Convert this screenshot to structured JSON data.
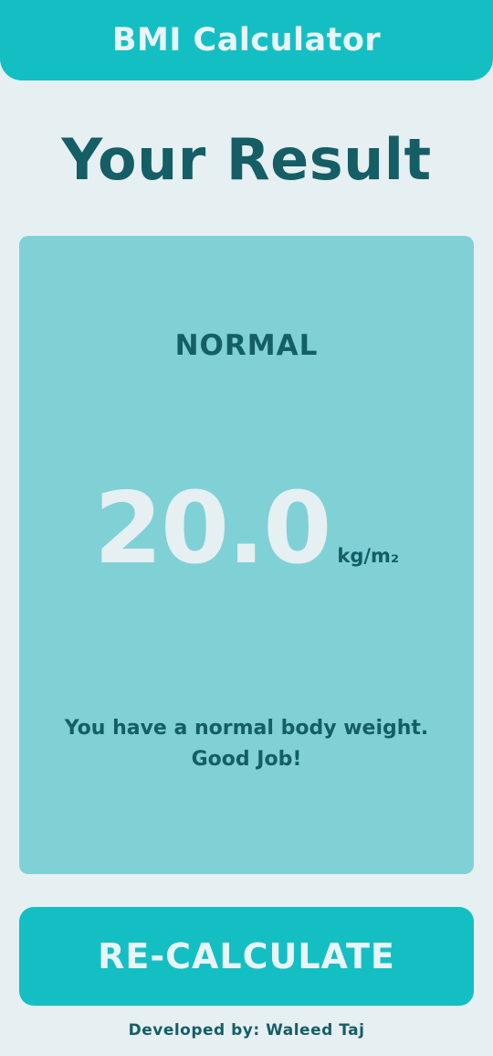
{
  "app_bar": {
    "title": "BMI Calculator"
  },
  "page": {
    "heading": "Your Result"
  },
  "result": {
    "category": "NORMAL",
    "bmi_value": "20.0",
    "unit": "kg/m₂",
    "message_line1": "You have a normal body weight.",
    "message_line2": "Good Job!"
  },
  "actions": {
    "recalculate_label": "RE-CALCULATE"
  },
  "footer": {
    "credit": "Developed by: Waleed Taj"
  },
  "colors": {
    "accent": "#14bfc4",
    "card": "#80d1d6",
    "dark_text": "#155e66",
    "background": "#e6eff2"
  }
}
